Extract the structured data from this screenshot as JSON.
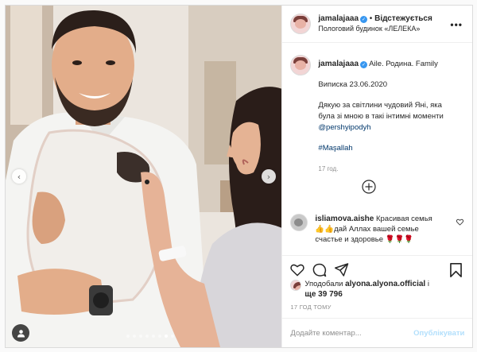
{
  "header": {
    "username": "jamalajaaa",
    "separator": "•",
    "follow_label": "Відстежується",
    "location": "Пологовий будинок «ЛЕЛЕКА»",
    "more_label": "•••"
  },
  "caption": {
    "username": "jamalajaaa",
    "title": "Aile. Родина. Family",
    "line1": "Виписка 23.06.2020",
    "line2a": "Дякую за світлини чудовий Яні, яка",
    "line2b": "була зі мною в такі інтимні моменти",
    "mention": "@pershyipodyh",
    "hashtag": "#Maşallah",
    "time": "17 год."
  },
  "comment": {
    "username": "isliamova.aishe",
    "text_a": "Красивая семья",
    "emoji_a": "👍👍",
    "text_b": "дай Аллах вашей семье",
    "text_c": "счастье и здоровье",
    "emoji_c": "🌹🌹🌹"
  },
  "likes": {
    "prefix": "Уподобали",
    "user": "alyona.alyona.official",
    "and": "і",
    "more": "ще 39 796"
  },
  "time_ago": "17 ГОД ТОМУ",
  "add_comment": {
    "placeholder": "Додайте коментар...",
    "publish_label": "Опублікувати"
  },
  "icons": {
    "verified": "✓",
    "prev": "‹",
    "next": "›"
  },
  "carousel": {
    "slides": 8,
    "active": 6
  },
  "colors": {
    "link": "#00376b",
    "verified": "#3897f0",
    "publish_disabled": "#b2dffc"
  }
}
